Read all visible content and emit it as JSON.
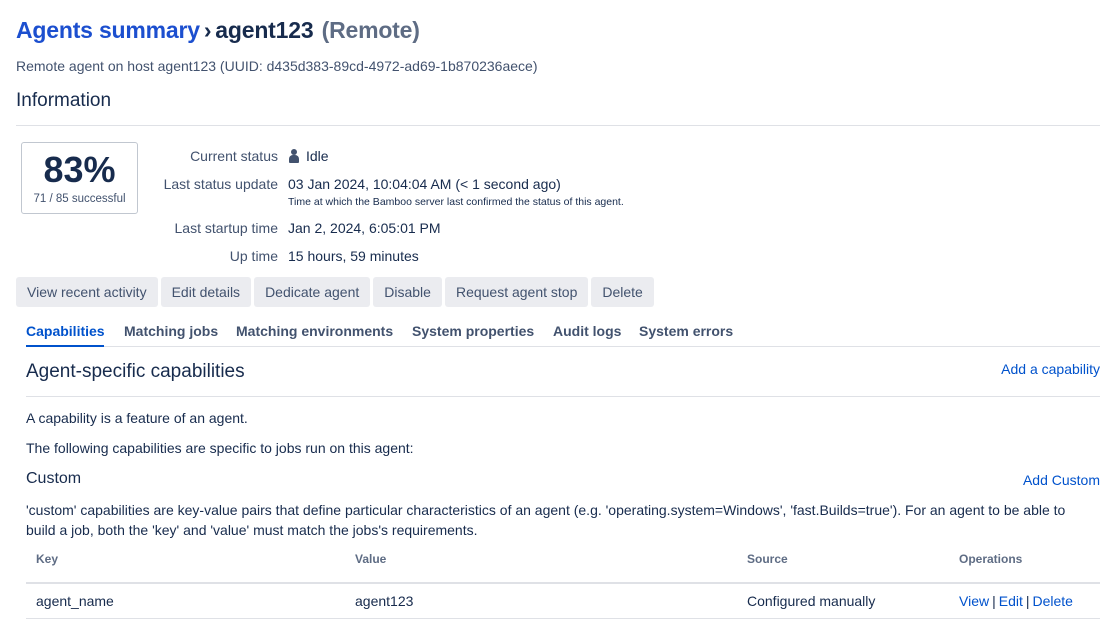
{
  "header": {
    "breadcrumb_link": "Agents summary",
    "separator": "›",
    "agent_name": "agent123",
    "agent_type": "(Remote)",
    "subtitle": "Remote agent on host agent123 (UUID: d435d383-89cd-4972-ad69-1b870236aece)"
  },
  "information": {
    "title": "Information",
    "success_rate": "83%",
    "success_count": "71 / 85 successful",
    "rows": {
      "current_status_label": "Current status",
      "current_status_value": "Idle",
      "last_update_label": "Last status update",
      "last_update_value": "03 Jan 2024, 10:04:04 AM (< 1 second ago)",
      "last_update_note": "Time at which the Bamboo server last confirmed the status of this agent.",
      "startup_label": "Last startup time",
      "startup_value": "Jan 2, 2024, 6:05:01 PM",
      "uptime_label": "Up time",
      "uptime_value": "15 hours, 59 minutes"
    }
  },
  "actions": [
    "View recent activity",
    "Edit details",
    "Dedicate agent",
    "Disable",
    "Request agent stop",
    "Delete"
  ],
  "tabs": [
    "Capabilities",
    "Matching jobs",
    "Matching environments",
    "System properties",
    "Audit logs",
    "System errors"
  ],
  "active_tab": "Capabilities",
  "capabilities": {
    "title": "Agent-specific capabilities",
    "add_link": "Add a capability",
    "para1": "A capability is a feature of an agent.",
    "para2": "The following capabilities are specific to jobs run on this agent:",
    "custom_title": "Custom",
    "add_custom_link": "Add Custom",
    "custom_desc": "'custom' capabilities are key-value pairs that define particular characteristics of an agent (e.g. 'operating.system=Windows', 'fast.Builds=true'). For an agent to be able to build a job, both the 'key' and 'value' must match the jobs's requirements.",
    "table": {
      "headers": {
        "key": "Key",
        "value": "Value",
        "source": "Source",
        "operations": "Operations"
      },
      "rows": [
        {
          "key": "agent_name",
          "value": "agent123",
          "source": "Configured manually",
          "op_view": "View",
          "op_edit": "Edit",
          "op_delete": "Delete",
          "op_sep": "|"
        }
      ]
    }
  },
  "colors": {
    "link": "#0052cc",
    "title_link": "#1c4fcf",
    "text": "#172b4d",
    "muted": "#42526e",
    "button_bg": "#ebecf0"
  },
  "icons": {
    "status": "person-icon"
  }
}
